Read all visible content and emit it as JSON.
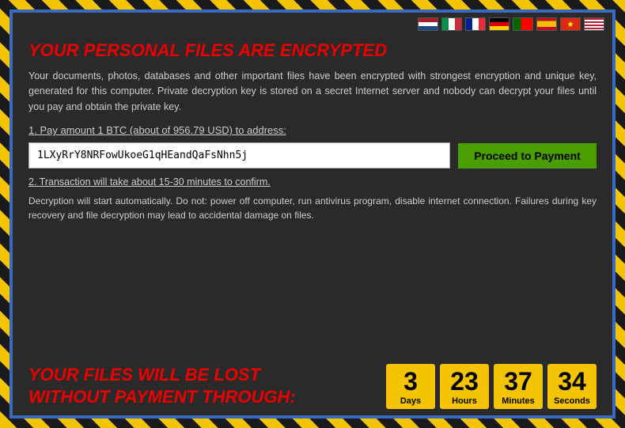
{
  "title": "YOUR PERSONAL FILES ARE ENCRYPTED",
  "description": "Your documents, photos, databases and other important files have been encrypted with strongest encryption and unique key, generated for this computer. Private decryption key is stored on a secret Internet server and nobody can decrypt your files until you pay and obtain the private key.",
  "step1_label": "1. Pay amount 1 BTC (about of 956.79 USD) to address:",
  "btc_address": "1LXyRrY8NRFowUkoeG1qHEandQaFsNhn5j",
  "payment_button_label": "Proceed to Payment",
  "step2_label": "2. Transaction will take about 15-30 minutes to confirm.",
  "decryption_note": "Decryption will start automatically. Do not: power off computer, run antivirus program, disable internet connection. Failures during key recovery and file decryption may lead to accidental damage on files.",
  "warning_line1": "YOUR FILES WILL BE LOST",
  "warning_line2": "WITHOUT PAYMENT THROUGH:",
  "countdown": {
    "days": {
      "value": "3",
      "label": "Days"
    },
    "hours": {
      "value": "23",
      "label": "Hours"
    },
    "minutes": {
      "value": "37",
      "label": "Minutes"
    },
    "seconds": {
      "value": "34",
      "label": "Seconds"
    }
  },
  "flags": [
    {
      "code": "nl",
      "label": "NL"
    },
    {
      "code": "it",
      "label": "IT"
    },
    {
      "code": "fr",
      "label": "FR"
    },
    {
      "code": "de",
      "label": "DE"
    },
    {
      "code": "pt",
      "label": "PT"
    },
    {
      "code": "es",
      "label": "ES"
    },
    {
      "code": "cn",
      "label": "CN"
    },
    {
      "code": "us",
      "label": "US"
    }
  ]
}
